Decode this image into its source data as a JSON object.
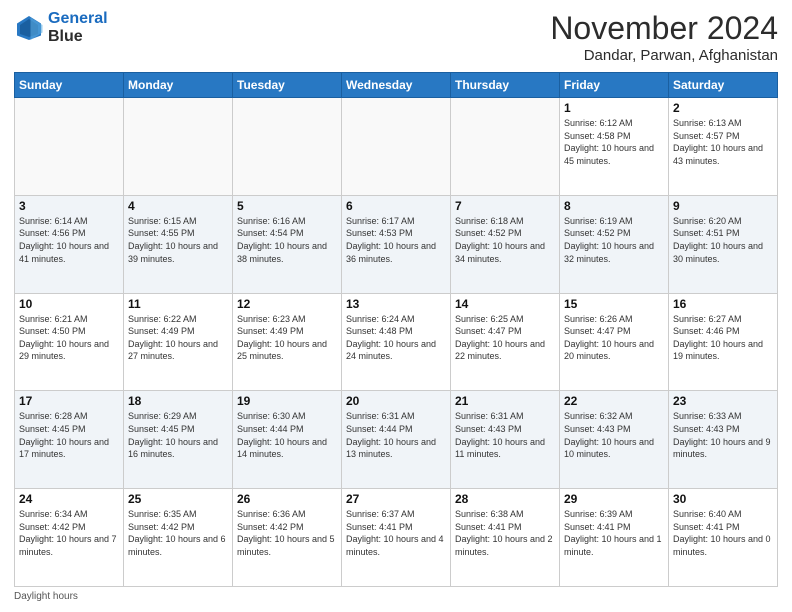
{
  "header": {
    "logo_line1": "General",
    "logo_line2": "Blue",
    "month": "November 2024",
    "location": "Dandar, Parwan, Afghanistan"
  },
  "days_of_week": [
    "Sunday",
    "Monday",
    "Tuesday",
    "Wednesday",
    "Thursday",
    "Friday",
    "Saturday"
  ],
  "weeks": [
    [
      {
        "day": "",
        "info": ""
      },
      {
        "day": "",
        "info": ""
      },
      {
        "day": "",
        "info": ""
      },
      {
        "day": "",
        "info": ""
      },
      {
        "day": "",
        "info": ""
      },
      {
        "day": "1",
        "info": "Sunrise: 6:12 AM\nSunset: 4:58 PM\nDaylight: 10 hours and 45 minutes."
      },
      {
        "day": "2",
        "info": "Sunrise: 6:13 AM\nSunset: 4:57 PM\nDaylight: 10 hours and 43 minutes."
      }
    ],
    [
      {
        "day": "3",
        "info": "Sunrise: 6:14 AM\nSunset: 4:56 PM\nDaylight: 10 hours and 41 minutes."
      },
      {
        "day": "4",
        "info": "Sunrise: 6:15 AM\nSunset: 4:55 PM\nDaylight: 10 hours and 39 minutes."
      },
      {
        "day": "5",
        "info": "Sunrise: 6:16 AM\nSunset: 4:54 PM\nDaylight: 10 hours and 38 minutes."
      },
      {
        "day": "6",
        "info": "Sunrise: 6:17 AM\nSunset: 4:53 PM\nDaylight: 10 hours and 36 minutes."
      },
      {
        "day": "7",
        "info": "Sunrise: 6:18 AM\nSunset: 4:52 PM\nDaylight: 10 hours and 34 minutes."
      },
      {
        "day": "8",
        "info": "Sunrise: 6:19 AM\nSunset: 4:52 PM\nDaylight: 10 hours and 32 minutes."
      },
      {
        "day": "9",
        "info": "Sunrise: 6:20 AM\nSunset: 4:51 PM\nDaylight: 10 hours and 30 minutes."
      }
    ],
    [
      {
        "day": "10",
        "info": "Sunrise: 6:21 AM\nSunset: 4:50 PM\nDaylight: 10 hours and 29 minutes."
      },
      {
        "day": "11",
        "info": "Sunrise: 6:22 AM\nSunset: 4:49 PM\nDaylight: 10 hours and 27 minutes."
      },
      {
        "day": "12",
        "info": "Sunrise: 6:23 AM\nSunset: 4:49 PM\nDaylight: 10 hours and 25 minutes."
      },
      {
        "day": "13",
        "info": "Sunrise: 6:24 AM\nSunset: 4:48 PM\nDaylight: 10 hours and 24 minutes."
      },
      {
        "day": "14",
        "info": "Sunrise: 6:25 AM\nSunset: 4:47 PM\nDaylight: 10 hours and 22 minutes."
      },
      {
        "day": "15",
        "info": "Sunrise: 6:26 AM\nSunset: 4:47 PM\nDaylight: 10 hours and 20 minutes."
      },
      {
        "day": "16",
        "info": "Sunrise: 6:27 AM\nSunset: 4:46 PM\nDaylight: 10 hours and 19 minutes."
      }
    ],
    [
      {
        "day": "17",
        "info": "Sunrise: 6:28 AM\nSunset: 4:45 PM\nDaylight: 10 hours and 17 minutes."
      },
      {
        "day": "18",
        "info": "Sunrise: 6:29 AM\nSunset: 4:45 PM\nDaylight: 10 hours and 16 minutes."
      },
      {
        "day": "19",
        "info": "Sunrise: 6:30 AM\nSunset: 4:44 PM\nDaylight: 10 hours and 14 minutes."
      },
      {
        "day": "20",
        "info": "Sunrise: 6:31 AM\nSunset: 4:44 PM\nDaylight: 10 hours and 13 minutes."
      },
      {
        "day": "21",
        "info": "Sunrise: 6:31 AM\nSunset: 4:43 PM\nDaylight: 10 hours and 11 minutes."
      },
      {
        "day": "22",
        "info": "Sunrise: 6:32 AM\nSunset: 4:43 PM\nDaylight: 10 hours and 10 minutes."
      },
      {
        "day": "23",
        "info": "Sunrise: 6:33 AM\nSunset: 4:43 PM\nDaylight: 10 hours and 9 minutes."
      }
    ],
    [
      {
        "day": "24",
        "info": "Sunrise: 6:34 AM\nSunset: 4:42 PM\nDaylight: 10 hours and 7 minutes."
      },
      {
        "day": "25",
        "info": "Sunrise: 6:35 AM\nSunset: 4:42 PM\nDaylight: 10 hours and 6 minutes."
      },
      {
        "day": "26",
        "info": "Sunrise: 6:36 AM\nSunset: 4:42 PM\nDaylight: 10 hours and 5 minutes."
      },
      {
        "day": "27",
        "info": "Sunrise: 6:37 AM\nSunset: 4:41 PM\nDaylight: 10 hours and 4 minutes."
      },
      {
        "day": "28",
        "info": "Sunrise: 6:38 AM\nSunset: 4:41 PM\nDaylight: 10 hours and 2 minutes."
      },
      {
        "day": "29",
        "info": "Sunrise: 6:39 AM\nSunset: 4:41 PM\nDaylight: 10 hours and 1 minute."
      },
      {
        "day": "30",
        "info": "Sunrise: 6:40 AM\nSunset: 4:41 PM\nDaylight: 10 hours and 0 minutes."
      }
    ]
  ],
  "footer": {
    "daylight_label": "Daylight hours"
  }
}
